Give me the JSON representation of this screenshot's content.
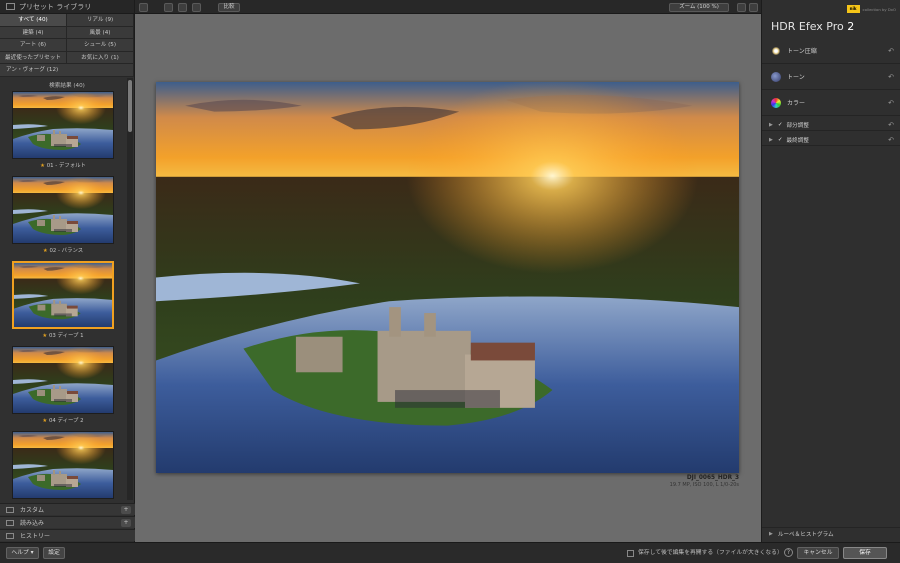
{
  "left_panel": {
    "header": "プリセット ライブラリ",
    "categories": [
      {
        "label": "すべて (40)"
      },
      {
        "label": "リアル (9)"
      },
      {
        "label": "建築 (4)"
      },
      {
        "label": "風景 (4)"
      },
      {
        "label": "アート (6)"
      },
      {
        "label": "シュール (5)"
      },
      {
        "label": "最近使ったプリセット"
      },
      {
        "label": "お気に入り (1)"
      },
      {
        "label": "アン・ヴォーグ (12)"
      }
    ],
    "results_title": "検索結果 (40)",
    "presets": [
      {
        "label": "01 - デフォルト"
      },
      {
        "label": "02 - バランス"
      },
      {
        "label": "03 ディープ 1"
      },
      {
        "label": "04 ディープ 2"
      }
    ],
    "star": "★",
    "sections": [
      "カスタム",
      "読み込み",
      "ヒストリー"
    ],
    "plus": "+"
  },
  "toolbar": {
    "compare_label": "比較",
    "zoom_label": "ズーム (100 %)"
  },
  "image_info": {
    "filename": "DJI_0065_HDR_3",
    "meta": "19.7 MP, ISO 100, L 1/0-20s"
  },
  "right_panel": {
    "brand_badge": "nik",
    "brand_sub": "collection by DxO",
    "title": "HDR Efex Pro",
    "title_version": "2",
    "rows": [
      "トーン圧縮",
      "トーン",
      "カラー"
    ],
    "sub_rows": [
      "部分調整",
      "最終調整"
    ],
    "bottom": "ルーペ＆ヒストグラム",
    "undo_glyph": "↶",
    "check_glyph": "✓",
    "tri_glyph": "▶"
  },
  "bottom_bar": {
    "help_label": "ヘルプ ▾",
    "settings_label": "設定",
    "reopen_label": "保存して後で編集を再開する（ファイルが大きくなる）",
    "help_icon": "?",
    "cancel_label": "キャンセル",
    "save_label": "保存"
  },
  "colors": {
    "selection": "#f0a020",
    "panel_bg": "#2f2f2f",
    "canvas_bg": "#6c6c6c"
  }
}
